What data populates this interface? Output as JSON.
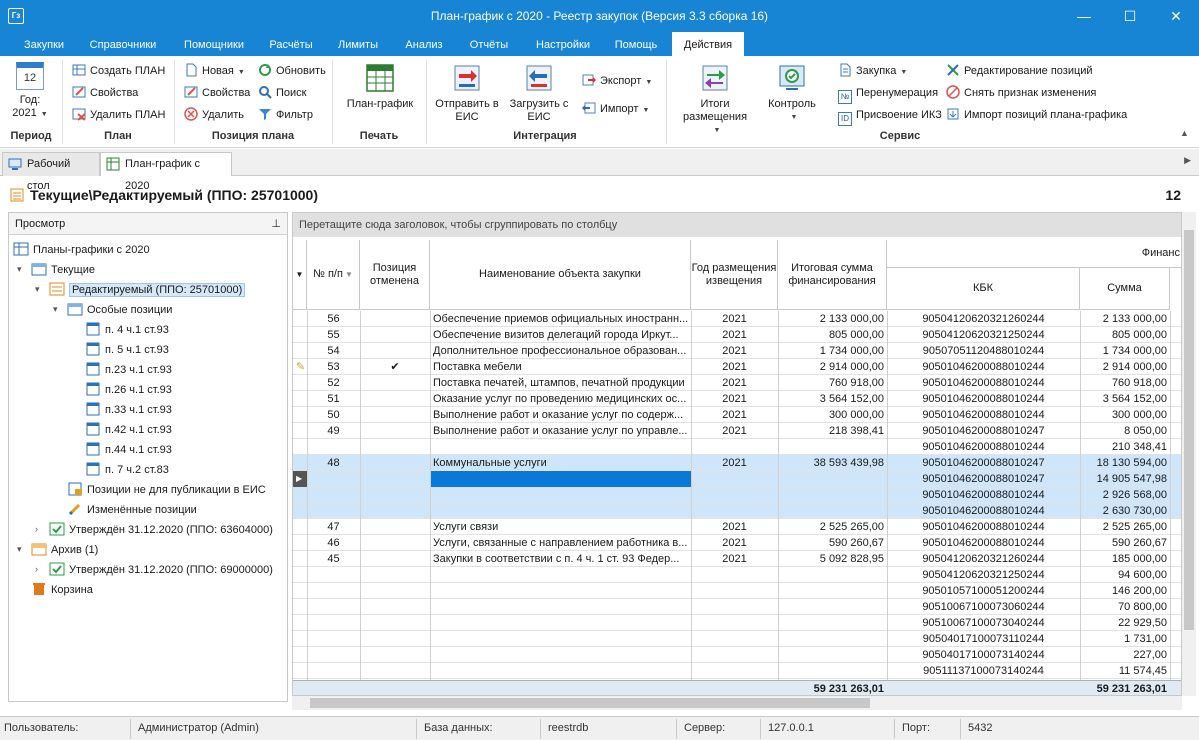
{
  "window": {
    "title": "План-график с 2020 - Реестр закупок (Версия 3.3 сборка 16)"
  },
  "menu": [
    "Закупки",
    "Справочники",
    "Помощники",
    "Расчёты",
    "Лимиты",
    "Анализ",
    "Отчёты",
    "Настройки",
    "Помощь",
    "Действия"
  ],
  "ribbon": {
    "period": {
      "label": "Период",
      "year_caption": "Год:",
      "year": "2021",
      "cal_day": "12"
    },
    "plan": {
      "label": "План",
      "items": [
        "Создать ПЛАН",
        "Свойства",
        "Удалить ПЛАН"
      ]
    },
    "position": {
      "label": "Позиция плана",
      "items": [
        "Новая",
        "Свойства",
        "Удалить",
        "Обновить",
        "Поиск",
        "Фильтр"
      ]
    },
    "print": {
      "label": "Печать",
      "item": "План-график"
    },
    "integration": {
      "label": "Интеграция",
      "send": "Отправить в ЕИС",
      "load": "Загрузить с ЕИС",
      "export": "Экспорт",
      "import": "Импорт"
    },
    "service": {
      "label": "Сервис",
      "results": "Итоги размещения",
      "control": "Контроль",
      "items": [
        "Закупка",
        "Перенумерация",
        "Присвоение ИКЗ",
        "Редактирование позиций",
        "Снять признак изменения",
        "Импорт позиций плана-графика"
      ]
    }
  },
  "tabs": [
    "Рабочий стол",
    "План-график с 2020"
  ],
  "header": {
    "title": "Текущие\\Редактируемый (ППО: 25701000)",
    "count": "12"
  },
  "tree": {
    "panel_title": "Просмотр",
    "nodes": [
      "Планы-графики с 2020",
      "Текущие",
      "Редактируемый (ППО: 25701000)",
      "Особые позиции",
      "п. 4 ч.1 ст.93",
      "п. 5 ч.1 ст.93",
      "п.23 ч.1 ст.93",
      "п.26 ч.1 ст.93",
      "п.33 ч.1 ст.93",
      "п.42 ч.1 ст.93",
      "п.44 ч.1 ст.93",
      "п. 7 ч.2 ст.83",
      "Позиции не для публикации в ЕИС",
      "Изменённые позиции",
      "Утверждён 31.12.2020 (ППО: 63604000)",
      "Архив (1)",
      "Утверждён 31.12.2020 (ППО: 69000000)",
      "Корзина"
    ]
  },
  "grid": {
    "group_hint": "Перетащите сюда заголовок, чтобы сгруппировать по столбцу",
    "columns": {
      "num": "№ п/п",
      "cancelled": "Позиция отменена",
      "name": "Наименование объекта закупки",
      "year": "Год размещения извещения",
      "total": "Итоговая сумма финансирования",
      "fin": "Финанс",
      "kbk": "КБК",
      "sum": "Сумма"
    },
    "rows": [
      {
        "num": "56",
        "cancel": "",
        "name": "Обеспечение приемов официальных иностранн...",
        "year": "2021",
        "total": "2 133 000,00",
        "kbk": "90504120620321260244",
        "sum": "2 133 000,00"
      },
      {
        "num": "55",
        "cancel": "",
        "name": "Обеспечение визитов делегаций города Иркут...",
        "year": "2021",
        "total": "805 000,00",
        "kbk": "90504120620321250244",
        "sum": "805 000,00"
      },
      {
        "num": "54",
        "cancel": "",
        "name": "Дополнительное профессиональное образован...",
        "year": "2021",
        "total": "1 734 000,00",
        "kbk": "90507051120488010244",
        "sum": "1 734 000,00"
      },
      {
        "num": "53",
        "cancel": "✔",
        "name": "Поставка мебели",
        "year": "2021",
        "total": "2 914 000,00",
        "kbk": "90501046200088010244",
        "sum": "2 914 000,00"
      },
      {
        "num": "52",
        "cancel": "",
        "name": "Поставка печатей, штампов, печатной продукции",
        "year": "2021",
        "total": "760 918,00",
        "kbk": "90501046200088010244",
        "sum": "760 918,00"
      },
      {
        "num": "51",
        "cancel": "",
        "name": "Оказание услуг по проведению медицинских ос...",
        "year": "2021",
        "total": "3 564 152,00",
        "kbk": "90501046200088010244",
        "sum": "3 564 152,00"
      },
      {
        "num": "50",
        "cancel": "",
        "name": "Выполнение работ и оказание услуг по содерж...",
        "year": "2021",
        "total": "300 000,00",
        "kbk": "90501046200088010244",
        "sum": "300 000,00"
      },
      {
        "num": "49",
        "cancel": "",
        "name": "Выполнение работ и оказание услуг по управле...",
        "year": "2021",
        "total": "218 398,41",
        "kbk": "90501046200088010247",
        "sum": "8 050,00"
      },
      {
        "num": "",
        "cancel": "",
        "name": "",
        "year": "",
        "total": "",
        "kbk": "90501046200088010244",
        "sum": "210 348,41"
      },
      {
        "num": "48",
        "cancel": "",
        "name": "Коммунальные услуги",
        "year": "2021",
        "total": "38 593 439,98",
        "kbk": "90501046200088010247",
        "sum": "18 130 594,00"
      },
      {
        "num": "",
        "cancel": "",
        "name": "",
        "year": "",
        "total": "",
        "kbk": "90501046200088010247",
        "sum": "14 905 547,98"
      },
      {
        "num": "",
        "cancel": "",
        "name": "",
        "year": "",
        "total": "",
        "kbk": "90501046200088010244",
        "sum": "2 926 568,00"
      },
      {
        "num": "",
        "cancel": "",
        "name": "",
        "year": "",
        "total": "",
        "kbk": "90501046200088010244",
        "sum": "2 630 730,00"
      },
      {
        "num": "47",
        "cancel": "",
        "name": "Услуги связи",
        "year": "2021",
        "total": "2 525 265,00",
        "kbk": "90501046200088010244",
        "sum": "2 525 265,00"
      },
      {
        "num": "46",
        "cancel": "",
        "name": "Услуги, связанные с направлением работника в...",
        "year": "2021",
        "total": "590 260,67",
        "kbk": "90501046200088010244",
        "sum": "590 260,67"
      },
      {
        "num": "45",
        "cancel": "",
        "name": "Закупки в соответствии с п. 4 ч. 1 ст. 93 Федер...",
        "year": "2021",
        "total": "5 092 828,95",
        "kbk": "90504120620321260244",
        "sum": "185 000,00"
      },
      {
        "num": "",
        "cancel": "",
        "name": "",
        "year": "",
        "total": "",
        "kbk": "90504120620321250244",
        "sum": "94 600,00"
      },
      {
        "num": "",
        "cancel": "",
        "name": "",
        "year": "",
        "total": "",
        "kbk": "90501057100051200244",
        "sum": "146 200,00"
      },
      {
        "num": "",
        "cancel": "",
        "name": "",
        "year": "",
        "total": "",
        "kbk": "90510067100073060244",
        "sum": "70 800,00"
      },
      {
        "num": "",
        "cancel": "",
        "name": "",
        "year": "",
        "total": "",
        "kbk": "90510067100073040244",
        "sum": "22 929,50"
      },
      {
        "num": "",
        "cancel": "",
        "name": "",
        "year": "",
        "total": "",
        "kbk": "90504017100073110244",
        "sum": "1 731,00"
      },
      {
        "num": "",
        "cancel": "",
        "name": "",
        "year": "",
        "total": "",
        "kbk": "90504017100073140244",
        "sum": "227,00"
      },
      {
        "num": "",
        "cancel": "",
        "name": "",
        "year": "",
        "total": "",
        "kbk": "90511137100073140244",
        "sum": "11 574,45"
      }
    ],
    "footer": {
      "total": "59 231 263,01",
      "sum": "59 231 263,01"
    }
  },
  "status": {
    "user_label": "Пользователь:",
    "user": "Администратор (Admin)",
    "db_label": "База данных:",
    "db": "reestrdb",
    "server_label": "Сервер:",
    "server": "127.0.0.1",
    "port_label": "Порт:",
    "port": "5432"
  },
  "colors": {
    "accent": "#1784d4",
    "selection": "#cfe6fa",
    "focus": "#0a78d7"
  }
}
